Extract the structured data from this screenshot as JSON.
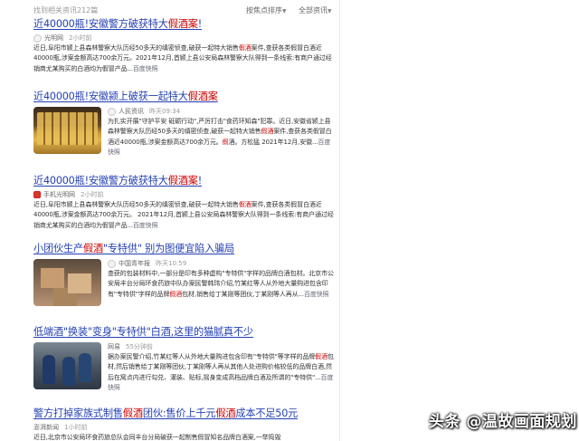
{
  "topbar": {
    "count": "找到相关资讯212篇",
    "sort_by_time": "按焦点排序",
    "all_news": "全部资讯"
  },
  "results": [
    {
      "title_pre": "近40000瓶!安徽警方破获特大",
      "title_hl": "假酒案",
      "title_post": "!",
      "source": "光明网",
      "time": "2小时前",
      "abstract_1": "近日,阜阳市颍上县森林警察大队历经50多天的缜密侦查,破获一起特大销售",
      "abstract_hl_1": "假酒",
      "abstract_2": "案件,查获各类假冒白酒近40000瓶,涉案金额高达700余万元。2021年12月,首颍上县公安局森林警察大队得到一条线索:有商户通过经销商尤某购买的白酒均为假冒产品...",
      "snapshot": "百度快照"
    },
    {
      "title_pre": "近40000瓶!安徽颍上破获一起特大",
      "title_hl": "假酒案",
      "title_post": "",
      "source": "人民资讯",
      "time": "昨天09:34",
      "abstract_1": "为扎实开展\"守护平安 砥砺行动\",严厉打击\"食药环知森\"犯罪。近日,安徽省颍上县森林警察大队历经50多天的缜密侦查,破获一起特大销售",
      "abstract_hl_1": "假酒",
      "abstract_2": "案件,查获各类假冒白酒近40000瓶,涉案金额高达700余万元。",
      "abstract_hl_2": "假",
      "abstract_3": "酒。方松猛 2021年12月,安徽...",
      "snapshot": "百度快照"
    },
    {
      "title_pre": "近40000瓶!安徽警方破获特大",
      "title_hl": "假酒案",
      "title_post": "!",
      "source": "手机光明网",
      "time": "2小时前",
      "abstract_1": "近日,阜阳市颍上县森林警察大队历经50多天的缜密侦查,破获一起特大销售",
      "abstract_hl_1": "假酒",
      "abstract_2": "案件,查获各类假冒白酒近40000瓶,涉案金额高达700余万元。 2021年12月,首颍上县公安局森林警察大队得到一条线索:有商户通过经销商尤某购买的白酒均为假冒产品...",
      "snapshot": "百度快照"
    },
    {
      "title_pre": "小团伙生产",
      "title_hl": "假酒",
      "title_post": "\"专特供\" 别为图便宜陷入骗局",
      "source": "中国青年报",
      "time": "昨天10:59",
      "abstract_1": "查获的包装材料中,一部分是印有多种虚构\"专特供\"字样的品牌白酒包材。北京市公安局丰台分局环食药旅中队办案民警韩玮介绍,竹某红等人从外地大量购进包含印有\"专特供\"字样的品牌",
      "abstract_hl_1": "假酒",
      "abstract_2": "包材,销售给丁某刚等团伙,丁某刚等人再从...",
      "snapshot": "百度快照"
    },
    {
      "title_pre": "低端酒\"换装\"变身\"专特供\"白酒,这里的猫腻真不少",
      "title_hl": "",
      "title_post": "",
      "source": "网易",
      "time": "55分钟前",
      "abstract_1": "据办案民警介绍,竹某红等人从外地大量购进包含印有\"专特供\"等字样的品牌",
      "abstract_hl_1": "假酒",
      "abstract_2": "包材,然后销售给丁某刚等团伙,丁某刚等人再从其他人处进购价格较低的品牌白酒,然后在窝点内进行勾兑、灌装、贴标,摇身变成高档品牌白酒及所谓的\"专特供\"...",
      "snapshot": "百度快照"
    },
    {
      "title_pre": "警方打掉家族式制售",
      "title_hl": "假酒",
      "title_post": "团伙:售价上千元",
      "title_hl_2": "假酒",
      "title_post_2": "成本不足50元",
      "source": "澎湃新闻",
      "time": "1小时前",
      "abstract_1": "近日,北京市公安局环食药旅总队会同丰台分局破获一起制售假冒知名品牌白酒案,一举捣毁",
      "abstract_hl_1": "",
      "abstract_2": "",
      "snapshot": ""
    }
  ],
  "watermark": "头条 @温故画面规划"
}
